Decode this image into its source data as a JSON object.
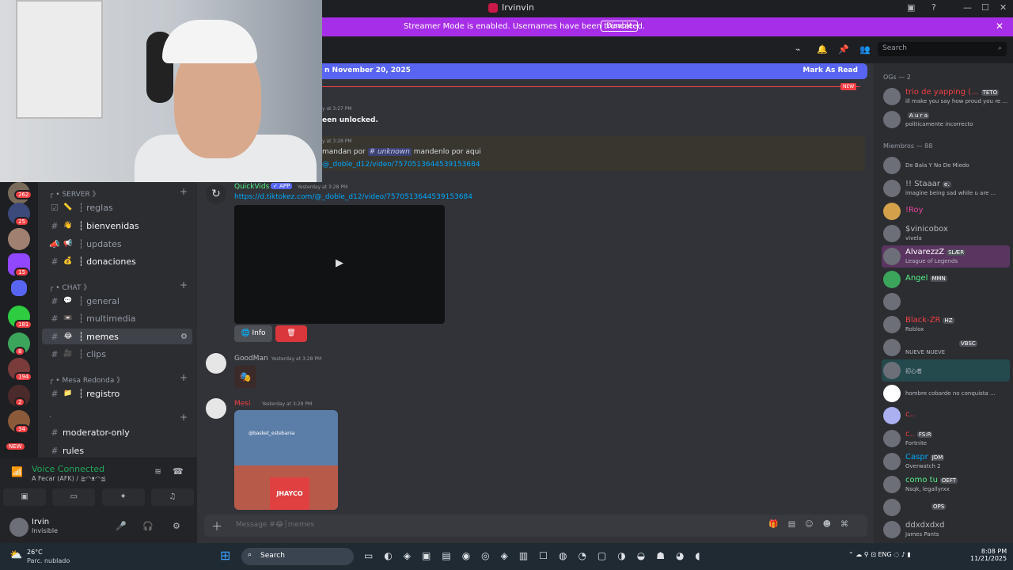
{
  "window": {
    "title": "Irvinvin",
    "min": "—",
    "max": "☐",
    "close": "✕"
  },
  "banner": {
    "text": "Streamer Mode is enabled. Usernames have been truncated.",
    "disable": "Disable"
  },
  "header": {
    "search_placeholder": "Search"
  },
  "new_bar": {
    "date_text": "n November 20, 2025",
    "mark_read": "Mark As Read",
    "new_tag": "NEW"
  },
  "servers": [
    {
      "badge": "262"
    },
    {
      "badge": "25"
    },
    {
      "badge": ""
    },
    {
      "badge": "15"
    },
    {
      "badge": ""
    },
    {
      "badge": "181"
    },
    {
      "badge": "8"
    },
    {
      "badge": "194"
    },
    {
      "badge": "2"
    },
    {
      "badge": "34"
    },
    {
      "badge": "NEW"
    }
  ],
  "channels": {
    "server_cat": "┌ • SERVER 》",
    "chat_cat": "┌ • CHAT 》",
    "mesa_cat": "┌ • Mesa Redonda 》",
    "blank_cat": ".",
    "items": [
      {
        "emoji": "📏",
        "name": "┆ reglas"
      },
      {
        "emoji": "👋",
        "name": "┆ bienvenidas"
      },
      {
        "emoji": "📢",
        "name": "┆ updates"
      },
      {
        "emoji": "💰",
        "name": "┆ donaciones"
      },
      {
        "emoji": "💬",
        "name": "┆ general"
      },
      {
        "emoji": "📼",
        "name": "┆ multimedia"
      },
      {
        "emoji": "😂",
        "name": "┆ memes"
      },
      {
        "emoji": "🎥",
        "name": "┆ clips"
      },
      {
        "emoji": "📁",
        "name": "┆ registro"
      },
      {
        "emoji": "",
        "name": "moderator-only"
      },
      {
        "emoji": "",
        "name": "rules"
      }
    ]
  },
  "voice": {
    "status": "Voice Connected",
    "sub": "A Fecar (AFK) / ≧◠ᴥ◠≦"
  },
  "user": {
    "name": "Irvin",
    "status": "Invisible"
  },
  "messages": {
    "sys_time": "y at 3:27 PM",
    "sys_text": "een unlocked.",
    "m1_time": "y at 3:28 PM",
    "m1_pre": "mandan por",
    "m1_mention": "# unknown",
    "m1_post": "mandenlo por aqui",
    "m1_link": "@_doble_d12/video/7570513644539153684",
    "qv_name": "QuickVids",
    "qv_app": "✓ APP",
    "qv_time": "Yesterday at 3:28 PM",
    "qv_link": "https://d.tiktokez.com/@_doble_d12/video/7570513644539153684",
    "info_btn": "🌐 Info",
    "gm_name": "GoodMan",
    "gm_time": "Yesterday at 3:28 PM",
    "mesi_name": "Mesi",
    "mesi_time": "Yesterday at 3:29 PM",
    "img_tag": "@basket_estebania",
    "img_jersey": "JHAYCO"
  },
  "composer": {
    "placeholder": "Message #😂┆memes"
  },
  "members": {
    "og_group": "OGs — 2",
    "mem_group": "Miembros — 88",
    "list": [
      {
        "name": "trio de yapping (...",
        "tag": "TETO",
        "status": "ill make you say how proud you re ...",
        "color": "#f23f43"
      },
      {
        "name": "",
        "tag": "A u r a",
        "status": "politicamente incorrecto",
        "color": "#dbdee1"
      },
      {
        "name": "",
        "tag": "",
        "status": "De Bala Y No De Miedo",
        "color": "#dbdee1"
      },
      {
        "name": "!! Staaar",
        "tag": "e.",
        "status": "imagine being sad while u are ...",
        "color": "#b5bac1"
      },
      {
        "name": "!Roy",
        "tag": "",
        "status": "",
        "color": "#eb459e"
      },
      {
        "name": "$vinicobox",
        "tag": "",
        "status": "vivela",
        "color": "#b5bac1"
      },
      {
        "name": "AlvarezzZ",
        "tag": "SLÆR",
        "status": "League of Legends",
        "color": "#ffffff"
      },
      {
        "name": "Angel",
        "tag": "MMN",
        "status": "",
        "color": "#57f287"
      },
      {
        "name": "",
        "tag": "",
        "status": "",
        "color": "#dbdee1"
      },
      {
        "name": "Black-ZR",
        "tag": "HZ",
        "status": "Roblox",
        "color": "#f23f43"
      },
      {
        "name": "",
        "tag": "VBSC",
        "status": "NUEVE NUEVE",
        "color": "#5865f2"
      },
      {
        "name": "",
        "tag": "",
        "status": "初心者",
        "color": "#dbdee1"
      },
      {
        "name": "",
        "tag": "",
        "status": "hombre cobarde no conquista ...",
        "color": "#dbdee1"
      },
      {
        "name": "c..",
        "tag": "",
        "status": "",
        "color": "#f23f43"
      },
      {
        "name": "c..",
        "tag": "FS:R",
        "status": "Fortnite",
        "color": "#f23f43"
      },
      {
        "name": "Caspr",
        "tag": "JDM",
        "status": "Overwatch 2",
        "color": "#00a8fc"
      },
      {
        "name": "como tu",
        "tag": "OEFT",
        "status": "Nsqk, legallyrxx",
        "color": "#57f287"
      },
      {
        "name": "",
        "tag": "OPS",
        "status": "",
        "color": "#dbdee1"
      },
      {
        "name": "ddxdxdxd",
        "tag": "",
        "status": "James Pants",
        "color": "#b5bac1"
      }
    ]
  },
  "taskbar": {
    "temp": "26°C",
    "weather": "Parc. nublado",
    "search": "Search",
    "lang": "ENG",
    "time": "8:08 PM",
    "date": "11/21/2025"
  }
}
